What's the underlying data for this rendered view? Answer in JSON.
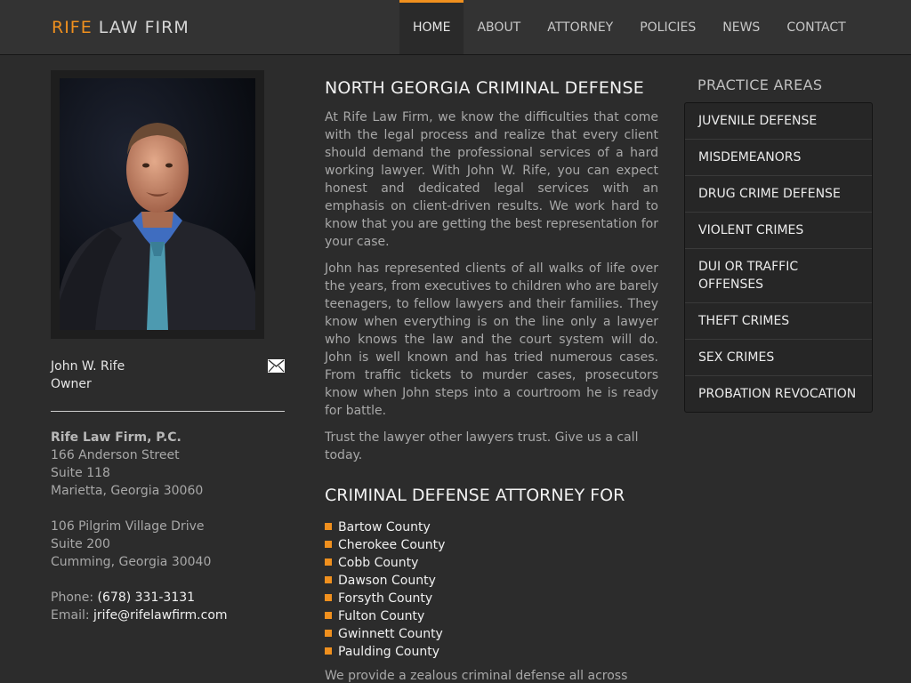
{
  "logo": {
    "part1": "RIFE",
    "part2": "LAW FIRM"
  },
  "nav": [
    {
      "label": "HOME",
      "active": true
    },
    {
      "label": "ABOUT"
    },
    {
      "label": "ATTORNEY"
    },
    {
      "label": "POLICIES"
    },
    {
      "label": "NEWS"
    },
    {
      "label": "CONTACT"
    }
  ],
  "profile": {
    "name": "John W. Rife",
    "role": "Owner"
  },
  "address": {
    "firm": "Rife Law Firm, P.C.",
    "office1": {
      "street": "166 Anderson Street",
      "suite": "Suite 118",
      "city": "Marietta, Georgia 30060"
    },
    "office2": {
      "street": "106 Pilgrim Village Drive",
      "suite": "Suite 200",
      "city": "Cumming, Georgia 30040"
    },
    "phone_label": "Phone:",
    "phone": "(678) 331-3131",
    "email_label": "Email:",
    "email": "jrife@rifelawfirm.com"
  },
  "main": {
    "heading": "NORTH GEORGIA CRIMINAL DEFENSE",
    "p1": "At Rife Law Firm, we know the difficulties that come with the legal process and realize that every client should demand the professional services of a hard working lawyer. With John W. Rife, you can expect honest and dedicated legal services with an emphasis on client-driven results. We work hard to know that you are getting the best representation for your case.",
    "p2": "John has represented clients of all walks of life over the years, from executives to children who are barely teenagers, to fellow lawyers and their families. They know when everything is on the line only a lawyer who knows the law and the court system will do. John is well known and has tried numerous cases. From traffic tickets to murder cases, prosecutors know when John steps into a courtroom he is ready for battle.",
    "p3": "Trust the lawyer other lawyers trust. Give us a call today.",
    "heading2": "CRIMINAL DEFENSE ATTORNEY FOR",
    "counties": [
      "Bartow County",
      "Cherokee County",
      "Cobb County",
      "Dawson County",
      "Forsyth County",
      "Fulton County",
      "Gwinnett County",
      "Paulding County"
    ],
    "tail": "We provide a zealous criminal defense all across"
  },
  "practice": {
    "title": "PRACTICE AREAS",
    "items": [
      "JUVENILE DEFENSE",
      "MISDEMEANORS",
      "DRUG CRIME DEFENSE",
      "VIOLENT CRIMES",
      "DUI OR TRAFFIC OFFENSES",
      "THEFT CRIMES",
      "SEX CRIMES",
      "PROBATION REVOCATION"
    ]
  },
  "colors": {
    "accent": "#f0901e",
    "background": "#2c2c2c",
    "header": "#333333"
  }
}
